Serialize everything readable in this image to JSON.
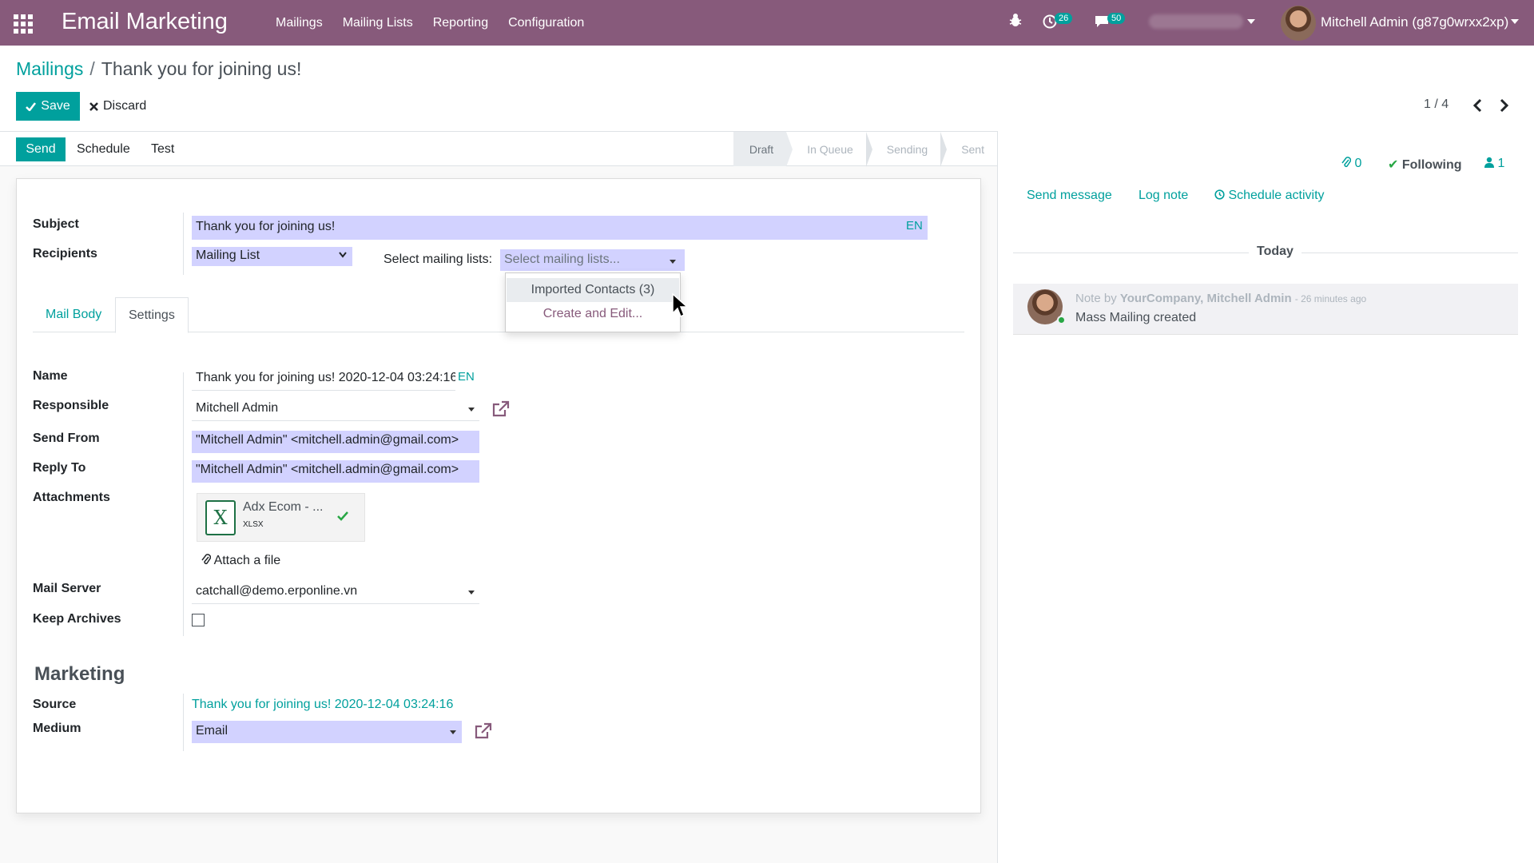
{
  "navbar": {
    "app_title": "Email Marketing",
    "menu": [
      "Mailings",
      "Mailing Lists",
      "Reporting",
      "Configuration"
    ],
    "activity_count": "26",
    "message_count": "50",
    "user_name": "Mitchell Admin (g87g0wrxx2xp)",
    "color": "#875a7b"
  },
  "breadcrumb": {
    "parent": "Mailings",
    "separator": "/",
    "current": "Thank you for joining us!"
  },
  "buttons": {
    "save": "Save",
    "discard": "Discard"
  },
  "pager": {
    "value": "1 / 4"
  },
  "statusbar": {
    "send": "Send",
    "schedule": "Schedule",
    "test": "Test",
    "stages": [
      "Draft",
      "In Queue",
      "Sending",
      "Sent"
    ],
    "active_stage": "Draft"
  },
  "form": {
    "subject_label": "Subject",
    "subject_value": "Thank you for joining us!",
    "lang": "EN",
    "recipients_label": "Recipients",
    "recipients_value": "Mailing List",
    "mailing_lists_label": "Select mailing lists:",
    "mailing_lists_placeholder": "Select mailing lists...",
    "dropdown_options": [
      "Imported Contacts (3)",
      "Create and Edit..."
    ],
    "tabs": [
      "Mail Body",
      "Settings"
    ],
    "active_tab": "Settings",
    "name_label": "Name",
    "name_value": "Thank you for joining us! 2020-12-04 03:24:16",
    "responsible_label": "Responsible",
    "responsible_value": "Mitchell Admin",
    "send_from_label": "Send From",
    "send_from_value": "\"Mitchell Admin\" <mitchell.admin@gmail.com>",
    "reply_to_label": "Reply To",
    "reply_to_value": "\"Mitchell Admin\" <mitchell.admin@gmail.com>",
    "attachments_label": "Attachments",
    "attachment_name": "Adx Ecom - ...",
    "attachment_ext": "XLSX",
    "attach_file": "Attach a file",
    "mail_server_label": "Mail Server",
    "mail_server_value": "catchall@demo.erponline.vn",
    "keep_archives_label": "Keep Archives",
    "keep_archives_checked": false,
    "marketing_title": "Marketing",
    "source_label": "Source",
    "source_value": "Thank you for joining us! 2020-12-04 03:24:16",
    "medium_label": "Medium",
    "medium_value": "Email",
    "accent_color": "#00a09d",
    "required_field_color": "#d2d2ff"
  },
  "chatter": {
    "attachments_count": "0",
    "following": "Following",
    "followers_count": "1",
    "send_message": "Send message",
    "log_note": "Log note",
    "schedule_activity": "Schedule activity",
    "today": "Today",
    "message": {
      "prefix": "Note by",
      "author": "YourCompany, Mitchell Admin",
      "time": "- 26 minutes ago",
      "body": "Mass Mailing created"
    }
  }
}
